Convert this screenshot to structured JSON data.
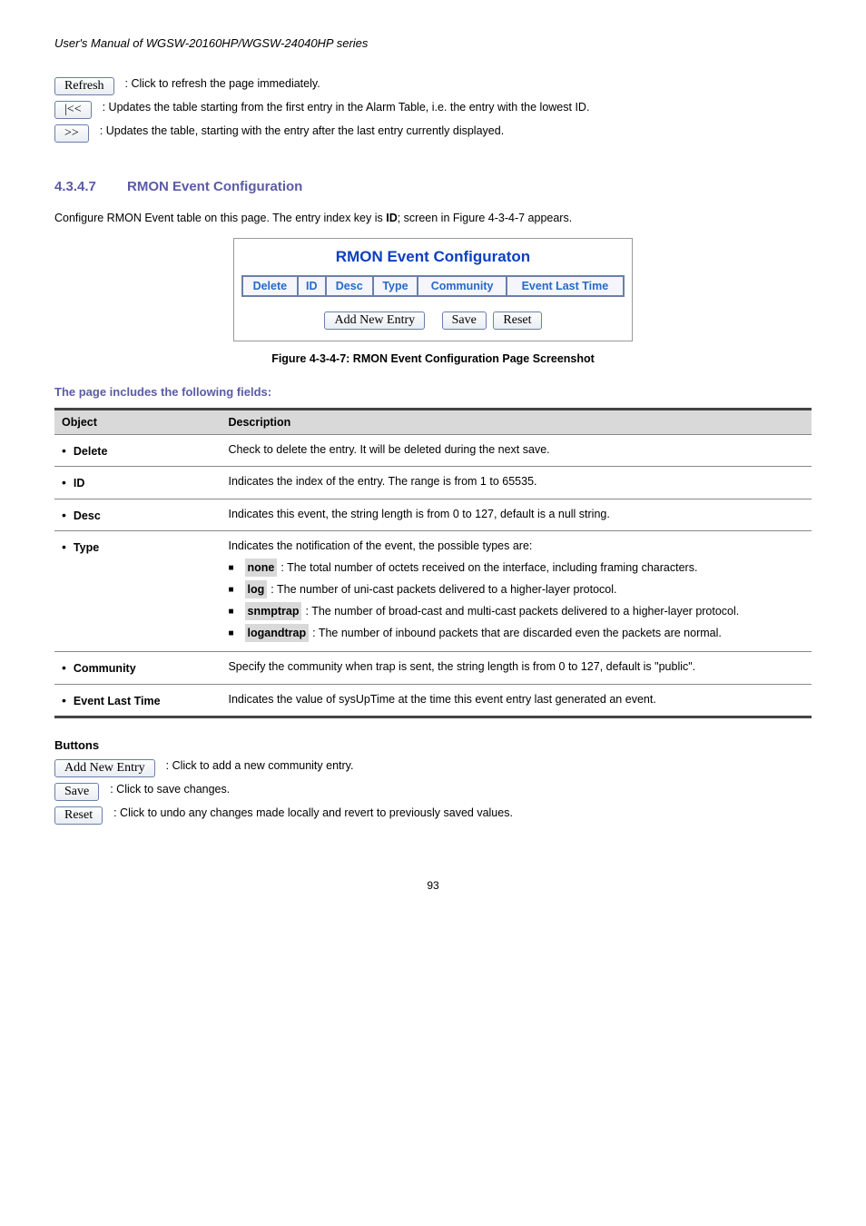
{
  "manual_header": "User's Manual of WGSW-20160HP/WGSW-24040HP series",
  "top_buttons": {
    "refresh": {
      "label": "Refresh",
      "desc": ": Click to refresh the page immediately."
    },
    "first": {
      "label": "|<<",
      "desc": ": Updates the table starting from the first entry in the Alarm Table, i.e. the entry with the lowest ID."
    },
    "next": {
      "label": ">>",
      "desc": ": Updates the table, starting with the entry after the last entry currently displayed."
    }
  },
  "section": {
    "number": "4.3.4.7",
    "title": "RMON Event Configuration"
  },
  "section_desc_1": "Configure RMON Event table on this page. The entry index key is ",
  "section_desc_id": "ID",
  "section_desc_2": "; screen in ",
  "section_desc_figref": "Figure 4-3-4-7",
  "section_desc_3": " appears.",
  "shot": {
    "title": "RMON Event Configuraton",
    "headers": [
      "Delete",
      "ID",
      "Desc",
      "Type",
      "Community",
      "Event Last Time"
    ],
    "btn_add": "Add New Entry",
    "btn_save": "Save",
    "btn_reset": "Reset"
  },
  "figcap_strong": "Figure 4-3-4-7:",
  "figcap_rest": " RMON Event Configuration Page Screenshot",
  "subhead": "The page includes the following fields:",
  "table": {
    "head_obj": "Object",
    "head_desc": "Description",
    "rows": [
      {
        "obj": "Delete",
        "desc_plain": "Check to delete the entry. It will be deleted during the next save."
      },
      {
        "obj": "ID",
        "desc_plain": "Indicates the index of the entry. The range is from 1 to 65535."
      },
      {
        "obj": "Desc",
        "desc_plain": "Indicates this event, the string length is from 0 to 127, default is a null string."
      },
      {
        "obj": "Type",
        "desc_intro": "Indicates the notification of the event, the possible types are:",
        "types": [
          {
            "label": "none",
            "text": ": The total number of octets received on the interface, including framing characters."
          },
          {
            "label": "log",
            "text": ": The number of uni-cast packets delivered to a higher-layer protocol."
          },
          {
            "label": "snmptrap",
            "text": ": The number of broad-cast and multi-cast packets delivered to a higher-layer protocol."
          },
          {
            "label": "logandtrap",
            "text": ": The number of inbound packets that are discarded even the packets are normal."
          }
        ]
      },
      {
        "obj": "Community",
        "desc_plain": "Specify the community when trap is sent, the string length is from 0 to 127, default is \"public\"."
      },
      {
        "obj": "Event Last Time",
        "desc_plain": "Indicates the value of sysUpTime at the time this event entry last generated an event."
      }
    ]
  },
  "buttons_head": "Buttons",
  "bottom_buttons": {
    "add": {
      "label": "Add New Entry",
      "desc": ": Click to add a new community entry."
    },
    "save": {
      "label": "Save",
      "desc": ": Click to save changes."
    },
    "reset": {
      "label": "Reset",
      "desc": ": Click to undo any changes made locally and revert to previously saved values."
    }
  },
  "pagenum": "93"
}
